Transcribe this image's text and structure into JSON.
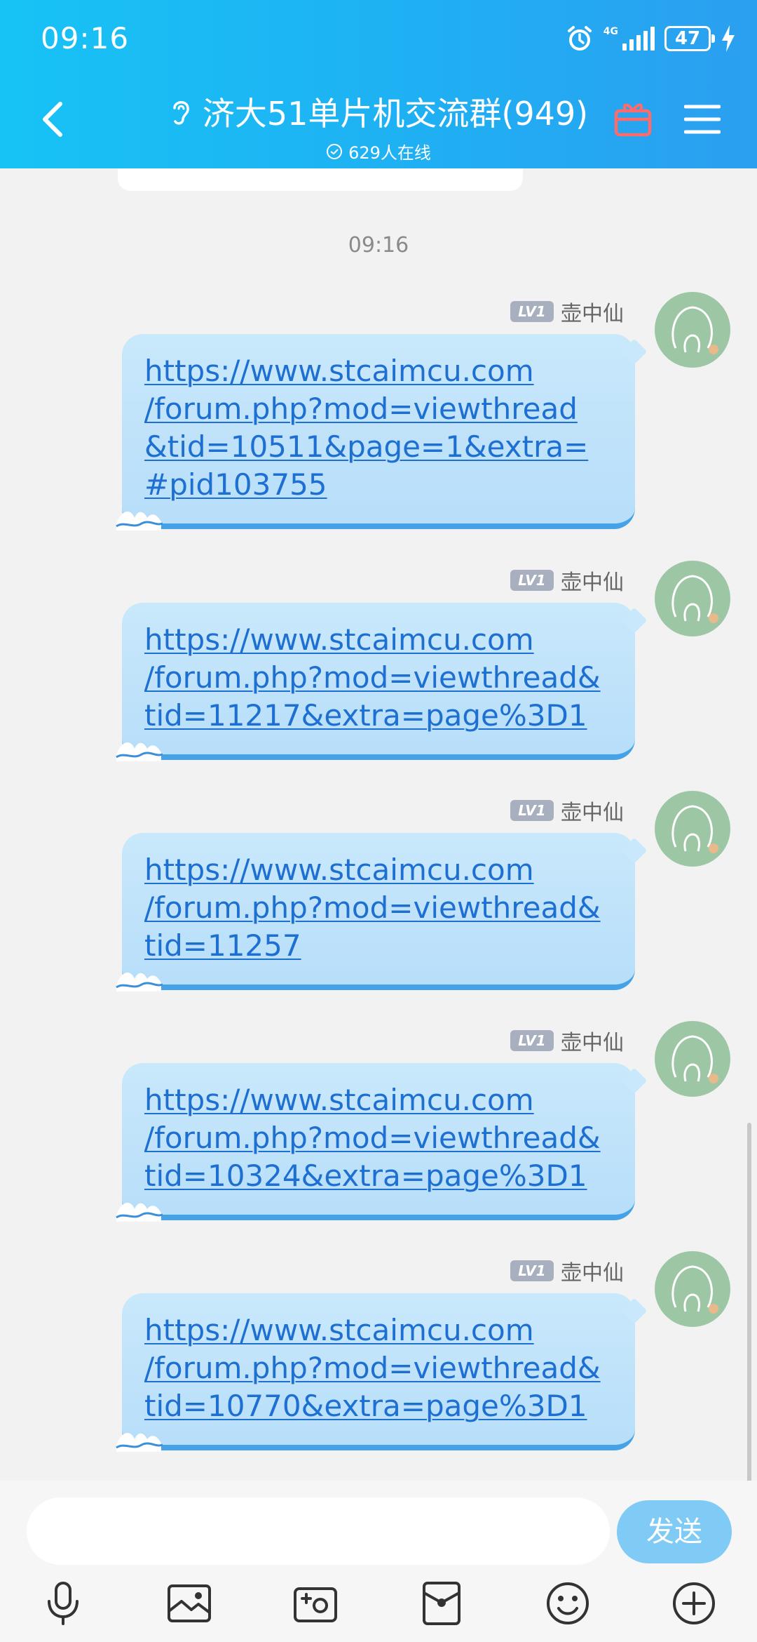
{
  "status_bar": {
    "time": "09:16",
    "network": "4G",
    "battery": "47"
  },
  "header": {
    "title": "济大51单片机交流群(949)",
    "online": "629人在线"
  },
  "chat": {
    "timestamp": "09:16",
    "messages": [
      {
        "level": "LV1",
        "sender": "壶中仙",
        "lines": [
          "https://www.stcaimcu.com",
          "/forum.php?mod=viewthread",
          "&tid=10511&page=1&extra=",
          "#pid103755"
        ]
      },
      {
        "level": "LV1",
        "sender": "壶中仙",
        "lines": [
          "https://www.stcaimcu.com",
          "/forum.php?mod=viewthread&",
          "tid=11217&extra=page%3D1"
        ]
      },
      {
        "level": "LV1",
        "sender": "壶中仙",
        "lines": [
          "https://www.stcaimcu.com",
          "/forum.php?mod=viewthread&",
          "tid=11257"
        ]
      },
      {
        "level": "LV1",
        "sender": "壶中仙",
        "lines": [
          "https://www.stcaimcu.com",
          "/forum.php?mod=viewthread&",
          "tid=10324&extra=page%3D1"
        ]
      },
      {
        "level": "LV1",
        "sender": "壶中仙",
        "lines": [
          "https://www.stcaimcu.com",
          "/forum.php?mod=viewthread&",
          "tid=10770&extra=page%3D1"
        ]
      }
    ]
  },
  "input": {
    "placeholder": "",
    "send_label": "发送"
  },
  "colors": {
    "header_start": "#17c3f5",
    "header_end": "#2b9ff0",
    "bubble": "#c9e8fb",
    "link": "#1d6fd1",
    "send_button": "#7fcbf5"
  },
  "icons": [
    "microphone-icon",
    "image-icon",
    "camera-icon",
    "red-packet-icon",
    "emoji-icon",
    "plus-icon"
  ]
}
